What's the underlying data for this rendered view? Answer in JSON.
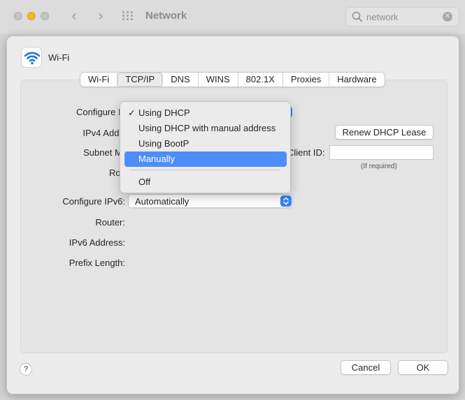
{
  "window": {
    "title": "Network",
    "search": {
      "placeholder": "network",
      "value": "network"
    }
  },
  "sheet": {
    "service_name": "Wi-Fi",
    "tabs": [
      "Wi-Fi",
      "TCP/IP",
      "DNS",
      "WINS",
      "802.1X",
      "Proxies",
      "Hardware"
    ],
    "active_tab": "TCP/IP",
    "labels": {
      "configure_ipv4": "Configure IPv4",
      "ipv4_address": "IPv4 Address",
      "subnet_mask": "Subnet Mask",
      "router": "Router",
      "dhcp_client_id": "Client ID:",
      "if_required": "(If required)",
      "configure_ipv6": "Configure IPv6:",
      "router6": "Router:",
      "ipv6_address": "IPv6 Address:",
      "prefix_length": "Prefix Length:"
    },
    "renew_button": "Renew DHCP Lease",
    "configure_ipv6_value": "Automatically",
    "help_label": "?",
    "cancel_button": "Cancel",
    "ok_button": "OK"
  },
  "ipv4_menu": {
    "checkmark": "✓",
    "items": [
      "Using DHCP",
      "Using DHCP with manual address",
      "Using BootP",
      "Manually",
      "Off"
    ],
    "checked": "Using DHCP",
    "highlighted": "Manually"
  },
  "colors": {
    "accent": "#3b82f6",
    "highlight": "#4e8df8",
    "minimize": "#f2b52b"
  }
}
